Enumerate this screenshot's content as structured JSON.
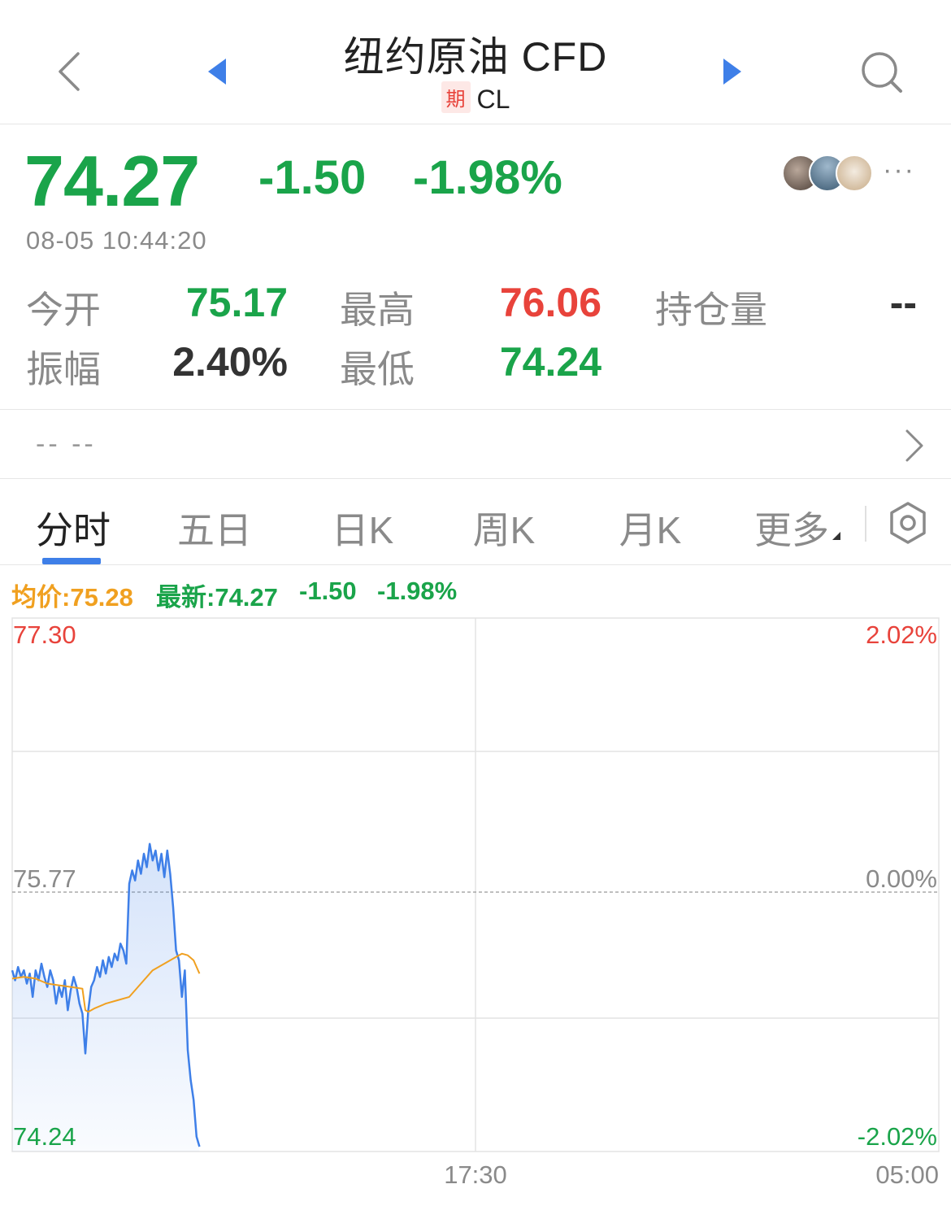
{
  "header": {
    "title": "纽约原油 CFD",
    "badge": "期",
    "code": "CL",
    "colors": {
      "arrow": "#3e7fe8",
      "icon": "#8a8a8a"
    }
  },
  "quote": {
    "price": "74.27",
    "change": "-1.50",
    "change_pct": "-1.98%",
    "datetime": "08-05 10:44:20",
    "more_label": "···"
  },
  "stats": {
    "open_label": "今开",
    "open_value": "75.17",
    "high_label": "最高",
    "high_value": "76.06",
    "oi_label": "持仓量",
    "oi_value": "--",
    "amplitude_label": "振幅",
    "amplitude_value": "2.40%",
    "low_label": "最低",
    "low_value": "74.24"
  },
  "news": {
    "text": "-- --"
  },
  "tabs": [
    {
      "label": "分时",
      "active": true
    },
    {
      "label": "五日",
      "active": false
    },
    {
      "label": "日K",
      "active": false
    },
    {
      "label": "周K",
      "active": false
    },
    {
      "label": "月K",
      "active": false
    },
    {
      "label": "更多",
      "active": false
    }
  ],
  "legend": {
    "avg": "均价:75.28",
    "latest": "最新:74.27",
    "change": "-1.50",
    "change_pct": "-1.98%"
  },
  "chart_data": {
    "type": "line",
    "y_left_labels": [
      "77.30",
      "75.77",
      "74.24"
    ],
    "y_right_labels": [
      "2.02%",
      "0.00%",
      "-2.02%"
    ],
    "x_labels": [
      "17:30",
      "05:00"
    ],
    "ylim": [
      74.24,
      77.3
    ],
    "reference_line": 75.77,
    "grid": true,
    "colors": {
      "price": "#3e7fe8",
      "avg": "#f0a020",
      "up": "#e8433b",
      "down": "#1aa44a"
    },
    "series": [
      {
        "name": "最新",
        "x": [
          0,
          1,
          2,
          3,
          4,
          5,
          6,
          7,
          8,
          9,
          10,
          11,
          12,
          13,
          14,
          15,
          16,
          17,
          18,
          19,
          20,
          21,
          22,
          23,
          24,
          25,
          26,
          27,
          28,
          29,
          30,
          31,
          32,
          33,
          34,
          35,
          36,
          37,
          38,
          39,
          40,
          41,
          42,
          43,
          44,
          45,
          46,
          47,
          48,
          49,
          50,
          51,
          52,
          53,
          54,
          55,
          56,
          57,
          58,
          59,
          60,
          61,
          62,
          63,
          64
        ],
        "values": [
          75.3,
          75.24,
          75.32,
          75.26,
          75.3,
          75.22,
          75.28,
          75.14,
          75.3,
          75.24,
          75.34,
          75.26,
          75.2,
          75.3,
          75.24,
          75.1,
          75.2,
          75.14,
          75.24,
          75.06,
          75.18,
          75.26,
          75.2,
          75.1,
          75.04,
          74.8,
          75.06,
          75.2,
          75.24,
          75.32,
          75.26,
          75.36,
          75.28,
          75.38,
          75.32,
          75.4,
          75.36,
          75.46,
          75.42,
          75.34,
          75.82,
          75.9,
          75.84,
          75.96,
          75.88,
          76.0,
          75.92,
          76.06,
          75.96,
          76.02,
          75.9,
          76.0,
          75.86,
          76.02,
          75.88,
          75.68,
          75.42,
          75.36,
          75.14,
          75.3,
          74.82,
          74.64,
          74.52,
          74.3,
          74.24
        ]
      },
      {
        "name": "均价",
        "x": [
          0,
          4,
          8,
          12,
          16,
          20,
          24,
          25,
          26,
          28,
          32,
          36,
          40,
          44,
          48,
          52,
          56,
          58,
          60,
          62,
          64
        ],
        "values": [
          75.25,
          75.26,
          75.25,
          75.22,
          75.21,
          75.2,
          75.19,
          75.06,
          75.05,
          75.07,
          75.1,
          75.12,
          75.14,
          75.22,
          75.3,
          75.34,
          75.38,
          75.4,
          75.39,
          75.36,
          75.28
        ]
      }
    ]
  }
}
